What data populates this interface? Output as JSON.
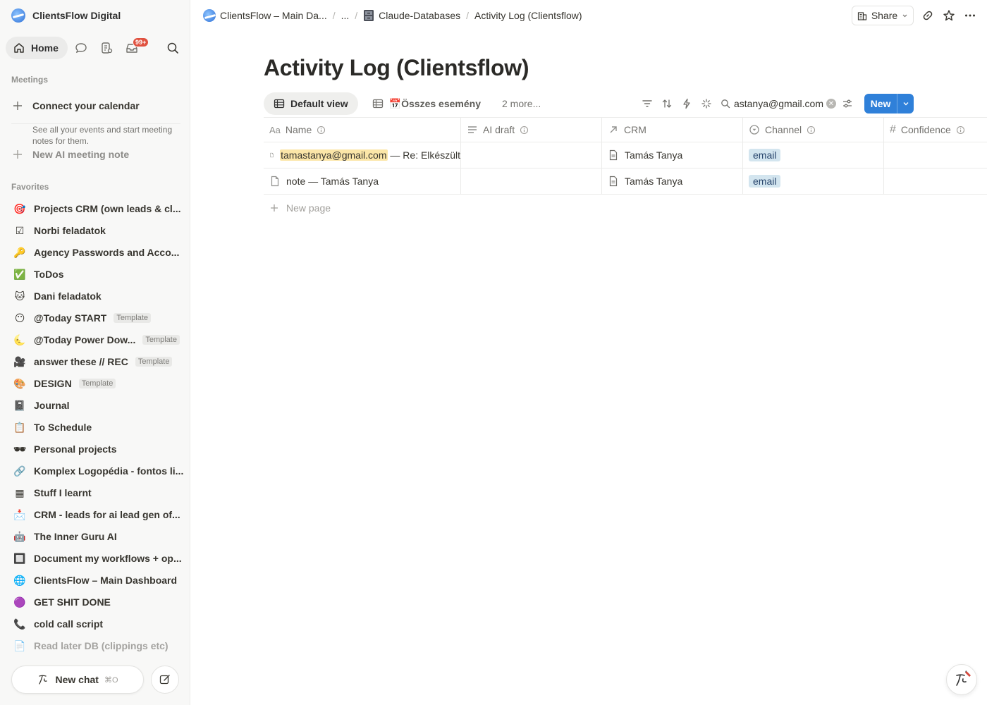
{
  "workspace": {
    "name": "ClientsFlow Digital"
  },
  "nav": {
    "home": "Home",
    "inbox_badge": "99+"
  },
  "meetings": {
    "heading": "Meetings",
    "connect_title": "Connect your calendar",
    "connect_desc": "See all your events and start meeting notes for them.",
    "new_note": "New AI meeting note"
  },
  "favorites": {
    "heading": "Favorites",
    "items": [
      {
        "label": "Projects CRM (own leads & cl...",
        "icon": "🎯",
        "tag": ""
      },
      {
        "label": "Norbi feladatok",
        "icon": "☑",
        "tag": ""
      },
      {
        "label": "Agency Passwords and Acco...",
        "icon": "🔑",
        "tag": ""
      },
      {
        "label": "ToDos",
        "icon": "✅",
        "tag": ""
      },
      {
        "label": "Dani feladatok",
        "icon": "🐱",
        "tag": ""
      },
      {
        "label": "@Today START",
        "icon": "😶",
        "tag": "Template"
      },
      {
        "label": "@Today Power Dow...",
        "icon": "🌜",
        "tag": "Template"
      },
      {
        "label": "answer these // REC",
        "icon": "🎥",
        "tag": "Template"
      },
      {
        "label": "DESIGN",
        "icon": "🎨",
        "tag": "Template"
      },
      {
        "label": "Journal",
        "icon": "📓",
        "tag": ""
      },
      {
        "label": "To Schedule",
        "icon": "📋",
        "tag": ""
      },
      {
        "label": "Personal projects",
        "icon": "🕶",
        "tag": ""
      },
      {
        "label": "Komplex Logopédia - fontos li...",
        "icon": "🔗",
        "tag": ""
      },
      {
        "label": "Stuff I learnt",
        "icon": "▦",
        "tag": ""
      },
      {
        "label": "CRM - leads for ai lead gen of...",
        "icon": "📩",
        "tag": ""
      },
      {
        "label": "The Inner Guru AI",
        "icon": "🤖",
        "tag": ""
      },
      {
        "label": "Document my workflows + op...",
        "icon": "🔲",
        "tag": ""
      },
      {
        "label": "ClientsFlow – Main Dashboard",
        "icon": "🌐",
        "tag": ""
      },
      {
        "label": "GET SHIT DONE",
        "icon": "🟣",
        "tag": ""
      },
      {
        "label": "cold call script",
        "icon": "📞",
        "tag": ""
      },
      {
        "label": "Read later DB (clippings etc)",
        "icon": "📄",
        "tag": ""
      }
    ]
  },
  "chat": {
    "label": "New chat",
    "shortcut": "⌘O"
  },
  "breadcrumb": {
    "items": [
      "ClientsFlow – Main Da...",
      "...",
      "Claude-Databases",
      "Activity Log (Clientsflow)"
    ],
    "sep": "/"
  },
  "header": {
    "share": "Share"
  },
  "page": {
    "title": "Activity Log (Clientsflow)"
  },
  "views": {
    "default": "Default view",
    "second": "📅Összes esemény",
    "more": "2 more..."
  },
  "search": {
    "value": "tamastanya@gmail.com"
  },
  "new_button": "New",
  "table": {
    "columns": [
      "Name",
      "AI draft",
      "CRM",
      "Channel",
      "Confidence"
    ],
    "rows": [
      {
        "name_highlight": "tamastanya@gmail.com",
        "name_rest": " — Re: Elkészült",
        "ai_draft": "",
        "crm": "Tamás Tanya",
        "channel": "email",
        "confidence": ""
      },
      {
        "name_highlight": "",
        "name_rest": "note — Tamás Tanya",
        "ai_draft": "",
        "crm": "Tamás Tanya",
        "channel": "email",
        "confidence": ""
      }
    ],
    "new_page": "New page"
  }
}
